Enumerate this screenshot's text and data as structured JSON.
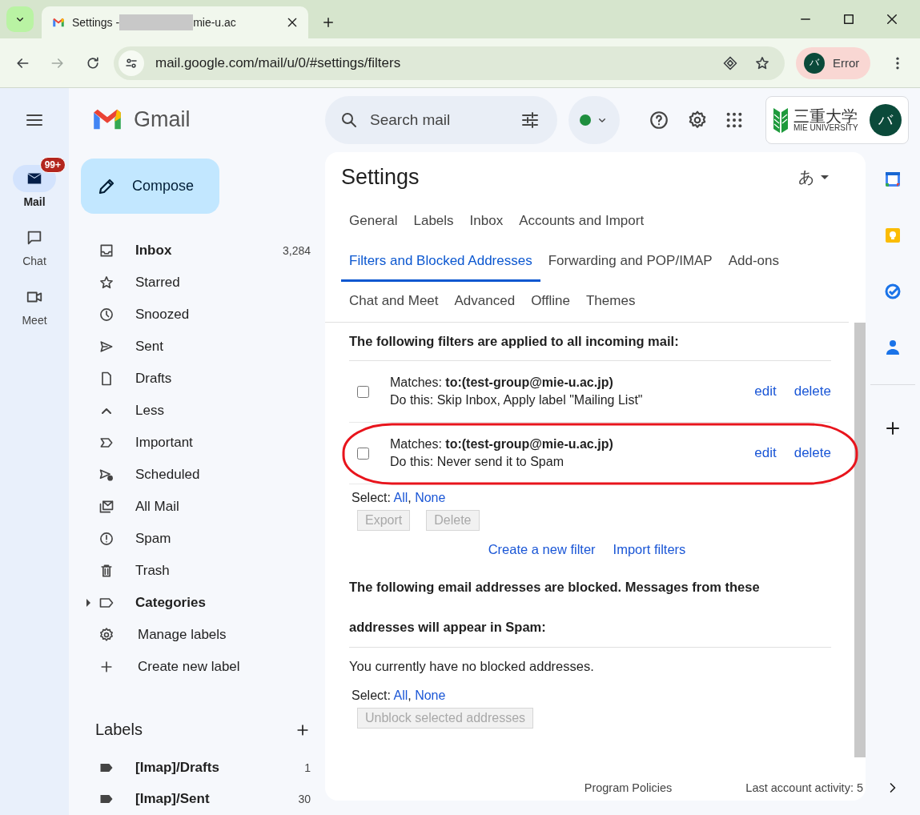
{
  "browser": {
    "tab": {
      "title_start": "Settings -",
      "title_end": "mie-u.ac"
    },
    "url": "mail.google.com/mail/u/0/#settings/filters",
    "profile": {
      "initial": "バ",
      "status": "Error"
    }
  },
  "rail": [
    {
      "label": "Mail",
      "selected": true,
      "badge": "99+"
    },
    {
      "label": "Chat",
      "selected": false
    },
    {
      "label": "Meet",
      "selected": false
    }
  ],
  "brand": "Gmail",
  "compose": "Compose",
  "nav": [
    {
      "kind": "folder",
      "label": "Inbox",
      "count": "3,284",
      "unread": true
    },
    {
      "kind": "folder",
      "label": "Starred",
      "unread": false
    },
    {
      "kind": "folder",
      "label": "Snoozed",
      "unread": false
    },
    {
      "kind": "folder",
      "label": "Sent",
      "unread": false
    },
    {
      "kind": "folder",
      "label": "Drafts",
      "unread": false
    },
    {
      "kind": "folder",
      "label": "Less",
      "unread": false
    },
    {
      "kind": "folder",
      "label": "Important",
      "unread": false
    },
    {
      "kind": "folder",
      "label": "Scheduled",
      "unread": false
    },
    {
      "kind": "folder",
      "label": "All Mail",
      "unread": false
    },
    {
      "kind": "folder",
      "label": "Spam",
      "unread": false
    },
    {
      "kind": "folder",
      "label": "Trash",
      "unread": false
    },
    {
      "kind": "group",
      "label": "Categories",
      "unread": true,
      "expanded": false
    },
    {
      "kind": "action",
      "label": "Manage labels",
      "unread": false
    },
    {
      "kind": "action",
      "label": "Create new label",
      "unread": false
    }
  ],
  "labels": {
    "title": "Labels",
    "items": [
      {
        "name": "[Imap]/Drafts",
        "count": "1",
        "unread": true
      },
      {
        "name": "[Imap]/Sent",
        "count": "30",
        "unread": true
      }
    ]
  },
  "search": {
    "placeholder": "Search mail"
  },
  "university_logo": {
    "text": "三重大学",
    "subtext": "MIE UNIVERSITY"
  },
  "account": {
    "initial": "バ"
  },
  "settings": {
    "title": "Settings",
    "input_tool": "あ",
    "tab_rows": [
      [
        {
          "label": "General",
          "selected": false
        },
        {
          "label": "Labels",
          "selected": false
        },
        {
          "label": "Inbox",
          "selected": false
        },
        {
          "label": "Accounts and Import",
          "selected": false
        }
      ],
      [
        {
          "label": "Filters and Blocked Addresses",
          "selected": true
        },
        {
          "label": "Forwarding and POP/IMAP",
          "selected": false
        },
        {
          "label": "Add-ons",
          "selected": false
        }
      ],
      [
        {
          "label": "Chat and Meet",
          "selected": false
        },
        {
          "label": "Advanced",
          "selected": false
        },
        {
          "label": "Offline",
          "selected": false
        },
        {
          "label": "Themes",
          "selected": false
        }
      ]
    ],
    "filters": {
      "heading": "The following filters are applied to all incoming mail:",
      "items": [
        {
          "matches": "Matches: **to:(test-group@mie-u.ac.jp)**",
          "action": "Do this: Skip Inbox, Apply label \"Mailing List\"",
          "checked": false,
          "highlighted": false,
          "edit": "edit",
          "delete": "delete"
        },
        {
          "matches": "Matches: **to:(test-group@mie-u.ac.jp)**",
          "action": "Do this: Never send it to Spam",
          "checked": false,
          "highlighted": true,
          "edit": "edit",
          "delete": "delete"
        }
      ],
      "select": {
        "label": "Select:",
        "all": "All",
        "separator": ",",
        "none": "None"
      },
      "buttons": [
        {
          "label": "Export",
          "disabled": true
        },
        {
          "label": "Delete",
          "disabled": true
        }
      ],
      "links": [
        "Create a new filter",
        "Import filters"
      ]
    },
    "blocked": {
      "heading": "The following email addresses are blocked. Messages from these addresses will appear in Spam:",
      "empty": "You currently have no blocked addresses.",
      "select": {
        "label": "Select:",
        "all": "All",
        "separator": ",",
        "none": "None"
      },
      "button": {
        "label": "Unblock selected addresses",
        "disabled": true
      }
    },
    "footer": {
      "policies": "Program Policies",
      "activity": "Last account activity: 5"
    }
  }
}
